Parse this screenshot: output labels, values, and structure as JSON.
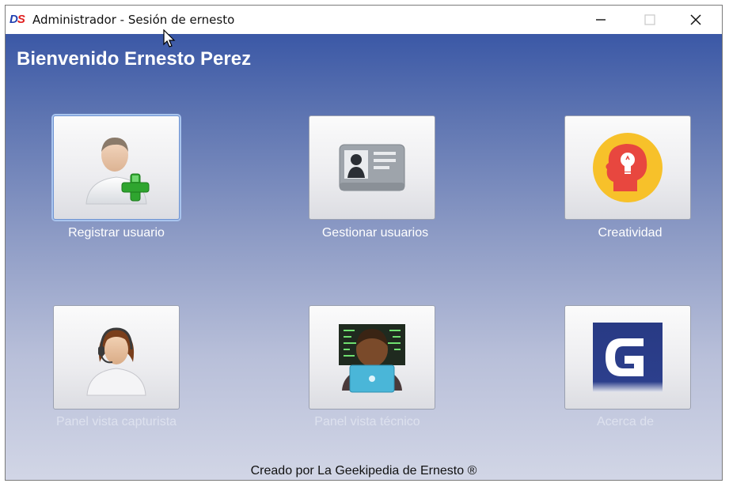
{
  "window": {
    "title": "Administrador - Sesión de ernesto",
    "logo": {
      "left": "D",
      "right": "S"
    },
    "controls": [
      "minimize-icon",
      "maximize-icon",
      "close-icon"
    ]
  },
  "header": {
    "welcome": "Bienvenido Ernesto Perez"
  },
  "tiles": [
    {
      "label": "Registrar usuario",
      "icon": "add-user-icon",
      "enabled": true
    },
    {
      "label": "Gestionar usuarios",
      "icon": "id-card-icon",
      "enabled": true
    },
    {
      "label": "Creatividad",
      "icon": "creativity-head-icon",
      "enabled": true
    },
    {
      "label": "Panel vista capturista",
      "icon": "operator-headset-icon",
      "enabled": false
    },
    {
      "label": "Panel vista técnico",
      "icon": "technician-screen-icon",
      "enabled": false
    },
    {
      "label": "Acerca de",
      "icon": "about-logo-icon",
      "enabled": false
    }
  ],
  "footer": {
    "credit": "Creado por La Geekipedia de Ernesto ®"
  },
  "colors": {
    "accent_blue": "#3b58a6",
    "logo_red": "#e02020",
    "logo_blue": "#1f3fb0"
  }
}
